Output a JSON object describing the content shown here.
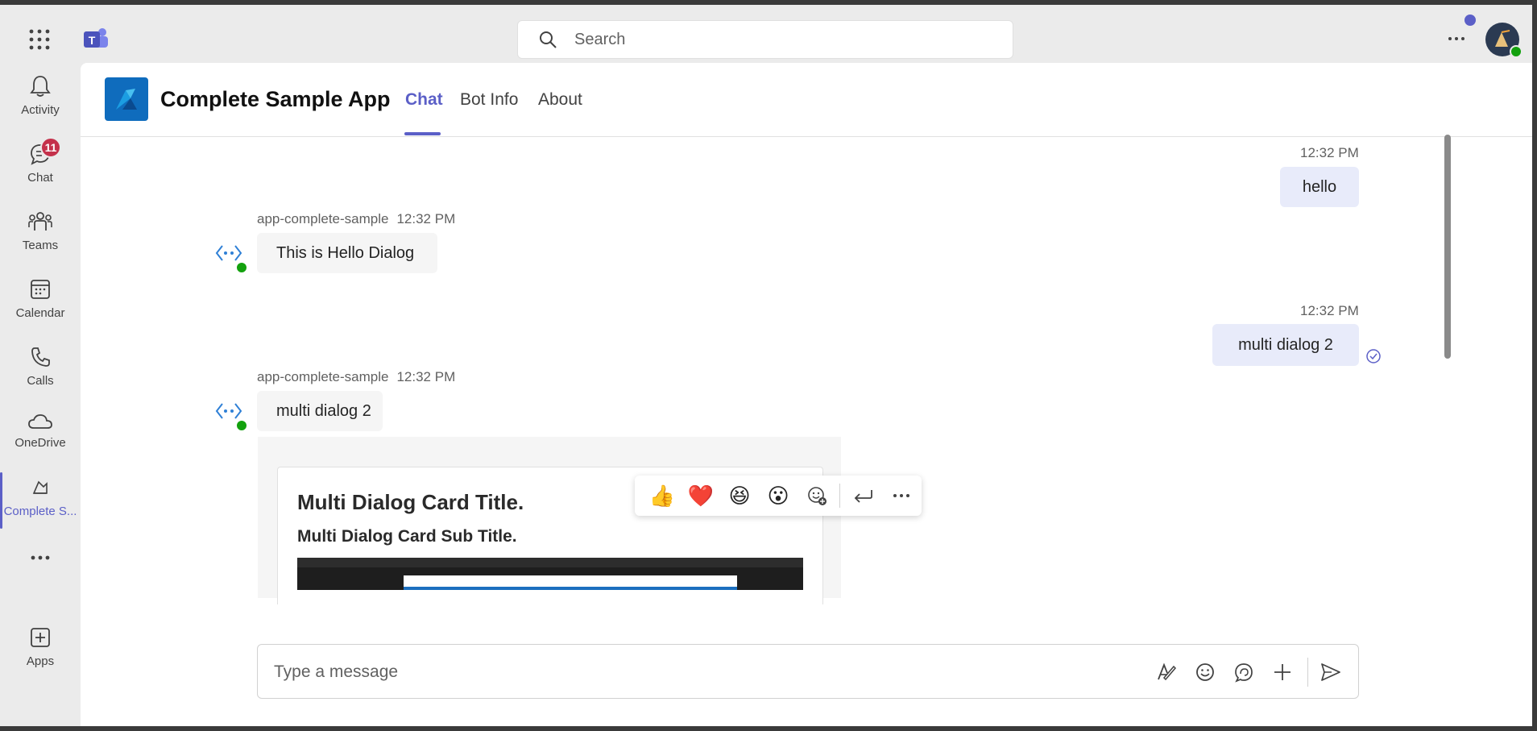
{
  "topbar": {
    "search_placeholder": "Search"
  },
  "rail": {
    "items": [
      {
        "label": "Activity",
        "icon": "bell-icon"
      },
      {
        "label": "Chat",
        "icon": "chat-icon",
        "badge": "11"
      },
      {
        "label": "Teams",
        "icon": "teams-icon"
      },
      {
        "label": "Calendar",
        "icon": "calendar-icon"
      },
      {
        "label": "Calls",
        "icon": "phone-icon"
      },
      {
        "label": "OneDrive",
        "icon": "cloud-icon"
      },
      {
        "label": "Complete S...",
        "icon": "app-icon",
        "active": true
      },
      {
        "label": "",
        "icon": "more-icon"
      },
      {
        "label": "Apps",
        "icon": "plus-square-icon"
      }
    ]
  },
  "header": {
    "app_title": "Complete Sample App",
    "tabs": [
      {
        "label": "Chat",
        "active": true
      },
      {
        "label": "Bot Info"
      },
      {
        "label": "About"
      }
    ]
  },
  "messages": [
    {
      "from": "me",
      "time": "12:32 PM",
      "text": "hello"
    },
    {
      "from": "bot",
      "sender": "app-complete-sample",
      "time": "12:32 PM",
      "text": "This is Hello Dialog"
    },
    {
      "from": "me",
      "time": "12:32 PM",
      "text": "multi dialog 2"
    },
    {
      "from": "bot",
      "sender": "app-complete-sample",
      "time": "12:32 PM",
      "text": "multi dialog 2"
    }
  ],
  "reactions": [
    "👍",
    "❤️",
    "😆",
    "😮"
  ],
  "card": {
    "title": "Multi Dialog Card Title.",
    "subtitle": "Multi Dialog Card Sub Title."
  },
  "composer": {
    "placeholder": "Type a message"
  },
  "colors": {
    "accent": "#5b5fc7",
    "badge": "#c4314b",
    "presence": "#13a10e",
    "my_bubble": "#e8ebfa"
  }
}
